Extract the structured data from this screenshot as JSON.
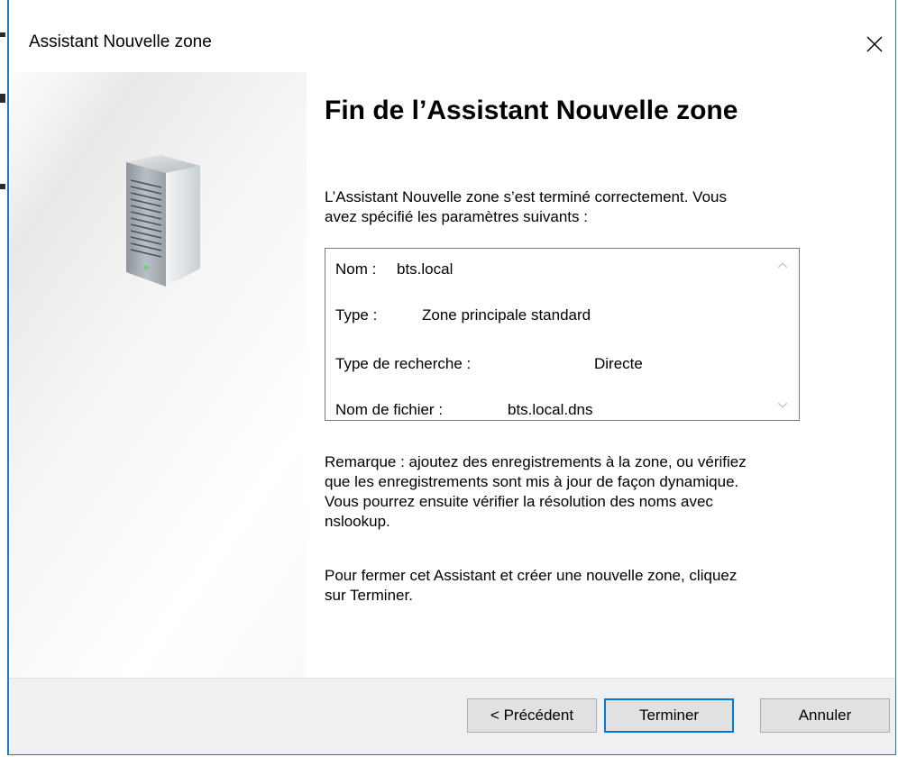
{
  "window": {
    "title": "Assistant Nouvelle zone"
  },
  "icons": {
    "close": "close-icon",
    "server": "server-icon",
    "scroll_up": "chevron-up-icon",
    "scroll_down": "chevron-down-icon"
  },
  "content": {
    "heading": "Fin de l’Assistant Nouvelle zone",
    "intro": "L’Assistant Nouvelle zone s’est terminé correctement. Vous\navez spécifié les paramètres suivants :",
    "summary": [
      {
        "label": "Nom :",
        "value": "bts.local"
      },
      {
        "label": "Type :",
        "value": "Zone principale standard"
      },
      {
        "label": "Type de recherche :",
        "value": "Directe"
      },
      {
        "label": "Nom de fichier :",
        "value": "bts.local.dns"
      }
    ],
    "remark": "Remarque : ajoutez des enregistrements à la zone, ou vérifiez\nque les enregistrements sont mis à jour de façon dynamique.\nVous pourrez ensuite vérifier la résolution des noms avec\nnslookup.",
    "closing": "Pour fermer cet Assistant et créer une nouvelle zone, cliquez\nsur Terminer."
  },
  "buttons": {
    "previous": "< Précédent",
    "finish": "Terminer",
    "cancel": "Annuler"
  },
  "colors": {
    "accent": "#0078d7",
    "window_border": "#1979ca",
    "footer_bg": "#f0f0f0",
    "button_bg": "#e1e1e1"
  }
}
